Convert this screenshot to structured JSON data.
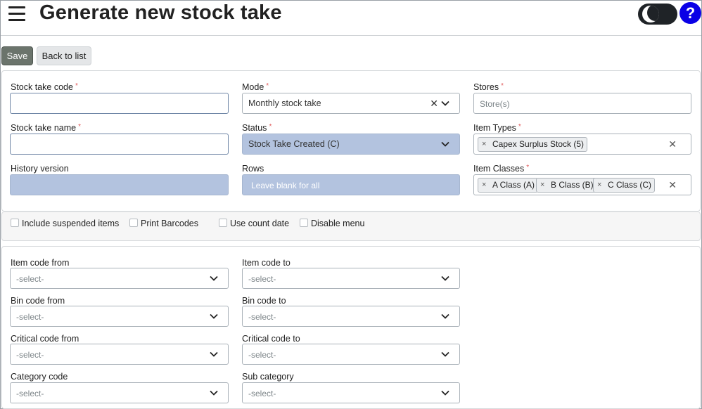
{
  "header": {
    "title": "Generate new stock take"
  },
  "toolbar": {
    "save_label": "Save",
    "back_label": "Back to list"
  },
  "form": {
    "stock_take_code": {
      "label": "Stock take code",
      "value": ""
    },
    "mode": {
      "label": "Mode",
      "value": "Monthly stock take"
    },
    "stores": {
      "label": "Stores",
      "placeholder": "Store(s)"
    },
    "stock_take_name": {
      "label": "Stock take name",
      "value": ""
    },
    "status": {
      "label": "Status",
      "value": "Stock Take Created (C)"
    },
    "item_types": {
      "label": "Item Types",
      "chips": [
        "Capex Surplus Stock (5)"
      ]
    },
    "history_version": {
      "label": "History version",
      "value": ""
    },
    "rows": {
      "label": "Rows",
      "placeholder": "Leave blank for all"
    },
    "item_classes": {
      "label": "Item Classes",
      "chips": [
        "A Class (A)",
        "B Class (B)",
        "C Class (C)"
      ]
    }
  },
  "options": {
    "include_suspended": {
      "label": "Include suspended items",
      "checked": false
    },
    "print_barcodes": {
      "label": "Print Barcodes",
      "checked": false
    },
    "use_count_date": {
      "label": "Use count date",
      "checked": false
    },
    "disable_menu": {
      "label": "Disable menu",
      "checked": false
    }
  },
  "filters": {
    "item_code_from": {
      "label": "Item code from",
      "value": "-select-"
    },
    "item_code_to": {
      "label": "Item code to",
      "value": "-select-"
    },
    "bin_code_from": {
      "label": "Bin code from",
      "value": "-select-"
    },
    "bin_code_to": {
      "label": "Bin code to",
      "value": "-select-"
    },
    "critical_code_from": {
      "label": "Critical code from",
      "value": "-select-"
    },
    "critical_code_to": {
      "label": "Critical code to",
      "value": "-select-"
    },
    "category_code": {
      "label": "Category code",
      "value": "-select-"
    },
    "sub_category": {
      "label": "Sub category",
      "value": "-select-"
    }
  },
  "symbols": {
    "required": "*",
    "clear": "✕",
    "chip_remove": "×",
    "help": "?"
  },
  "colors": {
    "save_button": "#6b746c",
    "help_button": "#0a00e6",
    "readonly_field": "#b3c3df",
    "required_asterisk": "#e05a5a"
  },
  "icons": [
    "menu-icon",
    "dark-mode-toggle-icon",
    "help-icon",
    "chevron-down-icon",
    "clear-icon",
    "chip-remove-icon",
    "checkbox-icon"
  ]
}
